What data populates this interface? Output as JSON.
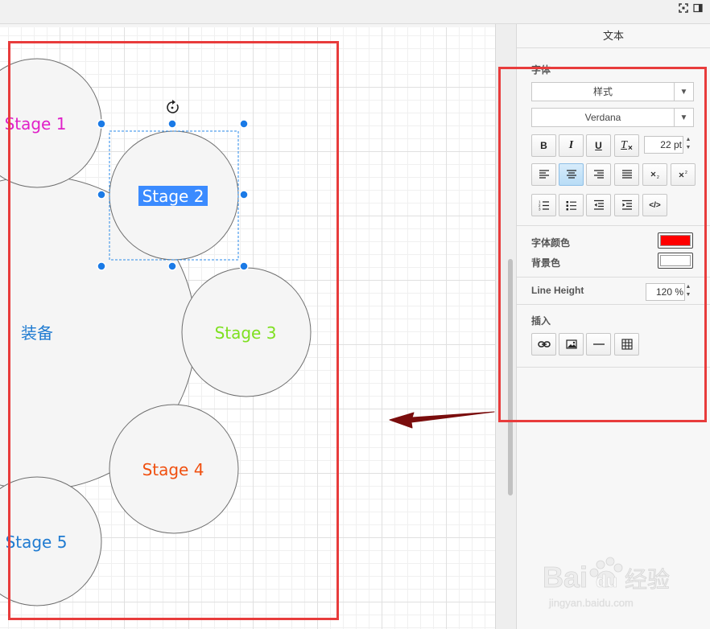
{
  "panel": {
    "title": "文本",
    "font_section": "字体",
    "style_dropdown": "样式",
    "font_dropdown": "Verdana",
    "font_size": "22 pt",
    "font_color_label": "字体颜色",
    "font_color": "#ff0000",
    "bg_color_label": "背景色",
    "bg_color": "#ffffff",
    "line_height_label": "Line Height",
    "line_height": "120 %",
    "insert_section": "插入"
  },
  "format_buttons": {
    "bold": "B",
    "italic": "I",
    "underline": "U",
    "clear": "T",
    "code": "</>"
  },
  "diagram": {
    "center_label": "装备",
    "center_color": "#1f7bd1",
    "stages": [
      {
        "label": "Stage 1",
        "color": "#e020c8"
      },
      {
        "label": "Stage 2",
        "color": "#ffffff",
        "highlight": "#3b8bff"
      },
      {
        "label": "Stage 3",
        "color": "#7ee020"
      },
      {
        "label": "Stage 4",
        "color": "#f05010"
      },
      {
        "label": "Stage 5",
        "color": "#1f7bd1"
      }
    ]
  },
  "watermark": {
    "brand": "Bai",
    "brand2": "du",
    "suffix": "经验",
    "url": "jingyan.baidu.com"
  },
  "colors": {
    "accent_red": "#e83c3c",
    "arrow": "#7a0d0d",
    "selection": "#2a8ae8"
  }
}
